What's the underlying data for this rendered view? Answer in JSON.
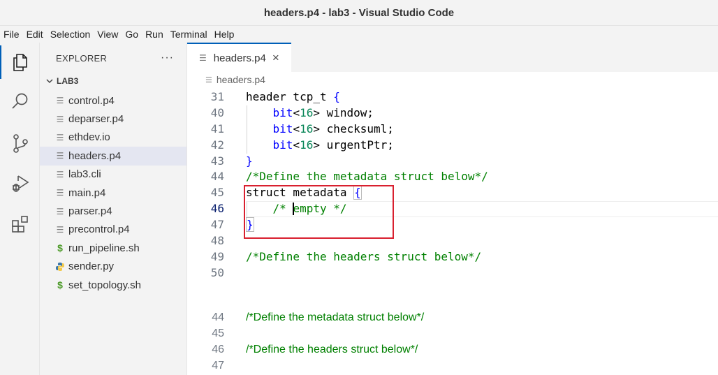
{
  "window": {
    "title": "headers.p4 - lab3 - Visual Studio Code"
  },
  "menu": [
    "File",
    "Edit",
    "Selection",
    "View",
    "Go",
    "Run",
    "Terminal",
    "Help"
  ],
  "activity_bar": {
    "items": [
      {
        "name": "explorer",
        "icon": "files-icon"
      },
      {
        "name": "search",
        "icon": "search-icon"
      },
      {
        "name": "source-control",
        "icon": "source-control-icon"
      },
      {
        "name": "run-debug",
        "icon": "run-debug-icon"
      },
      {
        "name": "extensions",
        "icon": "extensions-icon"
      }
    ]
  },
  "sidebar": {
    "title": "EXPLORER",
    "more": "···",
    "folder": "LAB3",
    "files": [
      {
        "name": "control.p4",
        "icon": "lines"
      },
      {
        "name": "deparser.p4",
        "icon": "lines"
      },
      {
        "name": "ethdev.io",
        "icon": "lines"
      },
      {
        "name": "headers.p4",
        "icon": "lines"
      },
      {
        "name": "lab3.cli",
        "icon": "lines"
      },
      {
        "name": "main.p4",
        "icon": "lines"
      },
      {
        "name": "parser.p4",
        "icon": "lines"
      },
      {
        "name": "precontrol.p4",
        "icon": "lines"
      },
      {
        "name": "run_pipeline.sh",
        "icon": "dollar"
      },
      {
        "name": "sender.py",
        "icon": "python"
      },
      {
        "name": "set_topology.sh",
        "icon": "dollar"
      }
    ],
    "selected": "headers.p4"
  },
  "editor": {
    "tab": {
      "label": "headers.p4",
      "close": "×"
    },
    "breadcrumb": "headers.p4",
    "sticky_line": {
      "number": "31",
      "text": "header tcp_t {"
    },
    "lines": [
      {
        "number": "40",
        "text": "    bit<16> window;"
      },
      {
        "number": "41",
        "text": "    bit<16> checksuml;"
      },
      {
        "number": "42",
        "text": "    bit<16> urgentPtr;"
      },
      {
        "number": "43",
        "text": "}"
      },
      {
        "number": "44",
        "text": "/*Define the metadata struct below*/"
      },
      {
        "number": "45",
        "text": "struct metadata {"
      },
      {
        "number": "46",
        "text": "    /* empty */"
      },
      {
        "number": "47",
        "text": "}"
      },
      {
        "number": "48",
        "text": ""
      },
      {
        "number": "49",
        "text": "/*Define the headers struct below*/"
      },
      {
        "number": "50",
        "text": ""
      }
    ],
    "second_lines": [
      {
        "number": "44",
        "text": "/*Define the metadata struct below*/"
      },
      {
        "number": "45",
        "text": ""
      },
      {
        "number": "46",
        "text": "/*Define the headers struct below*/"
      },
      {
        "number": "47",
        "text": ""
      }
    ]
  },
  "colors": {
    "keyword": "#0000ff",
    "number": "#098658",
    "comment": "#008000",
    "highlight_box": "#d9202f",
    "accent": "#005fb8"
  }
}
